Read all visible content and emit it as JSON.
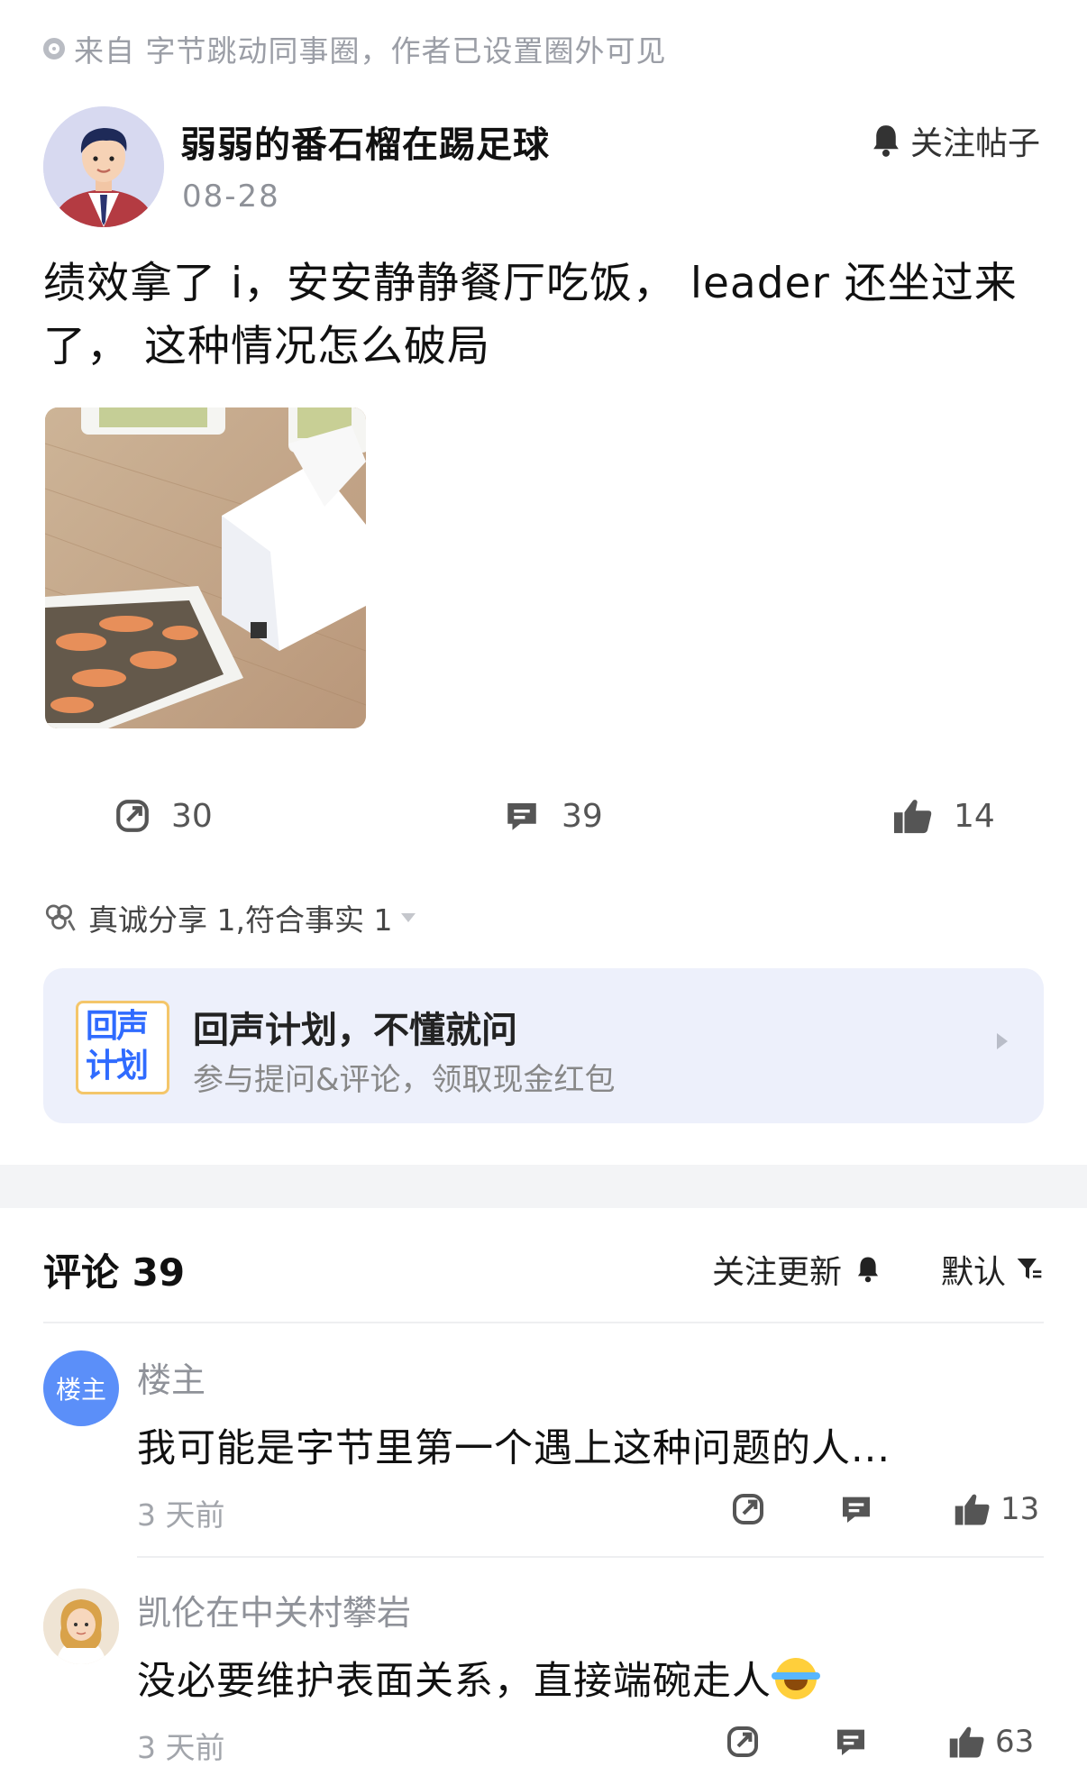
{
  "source_line": "来自 字节跳动同事圈，作者已设置圈外可见",
  "post": {
    "author": "弱弱的番石榴在踢足球",
    "date": "08-28",
    "follow_label": "关注帖子",
    "text": "绩效拿了 i，安安静静餐厅吃饭， leader 还坐过来了， 这种情况怎么破局",
    "actions": {
      "share_count": "30",
      "comment_count": "39",
      "like_count": "14"
    },
    "badges": "真诚分享 1,符合事实 1"
  },
  "promo": {
    "logo_text": "回声计划",
    "title": "回声计划，不懂就问",
    "subtitle": "参与提问&评论，领取现金红包"
  },
  "comments_header": {
    "title": "评论 39",
    "follow_updates": "关注更新",
    "sort": "默认"
  },
  "comments": [
    {
      "avatar_label": "楼主",
      "user": "楼主",
      "text": "我可能是字节里第一个遇上这种问题的人...",
      "time": "3 天前",
      "likes": "13"
    },
    {
      "user": "凯伦在中关村攀岩",
      "text": "没必要维护表面关系，直接端碗走人",
      "time": "3 天前",
      "likes": "63"
    }
  ],
  "colors": {
    "accent_blue": "#2f6bff",
    "promo_bg": "#edf0fb",
    "muted": "#9b9ea6"
  }
}
